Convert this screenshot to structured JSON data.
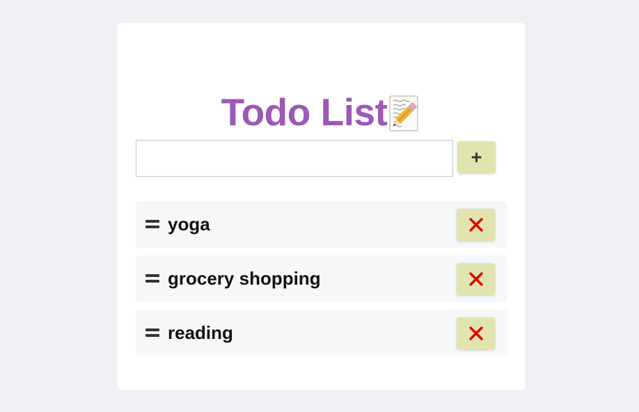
{
  "header": {
    "title": "Todo List",
    "title_icon": "memo-icon"
  },
  "add_form": {
    "input_value": "",
    "input_placeholder": "",
    "add_button_label": "+"
  },
  "todos": [
    {
      "text": "yoga"
    },
    {
      "text": "grocery shopping"
    },
    {
      "text": "reading"
    }
  ],
  "icons": {
    "drag": "drag-handle-icon",
    "delete": "close-icon"
  },
  "colors": {
    "background": "#eff0f4",
    "card": "#ffffff",
    "title": "#9b59b6",
    "button": "#e1e4ae",
    "delete_x": "#e00000",
    "item_bg": "#f6f7f9"
  }
}
